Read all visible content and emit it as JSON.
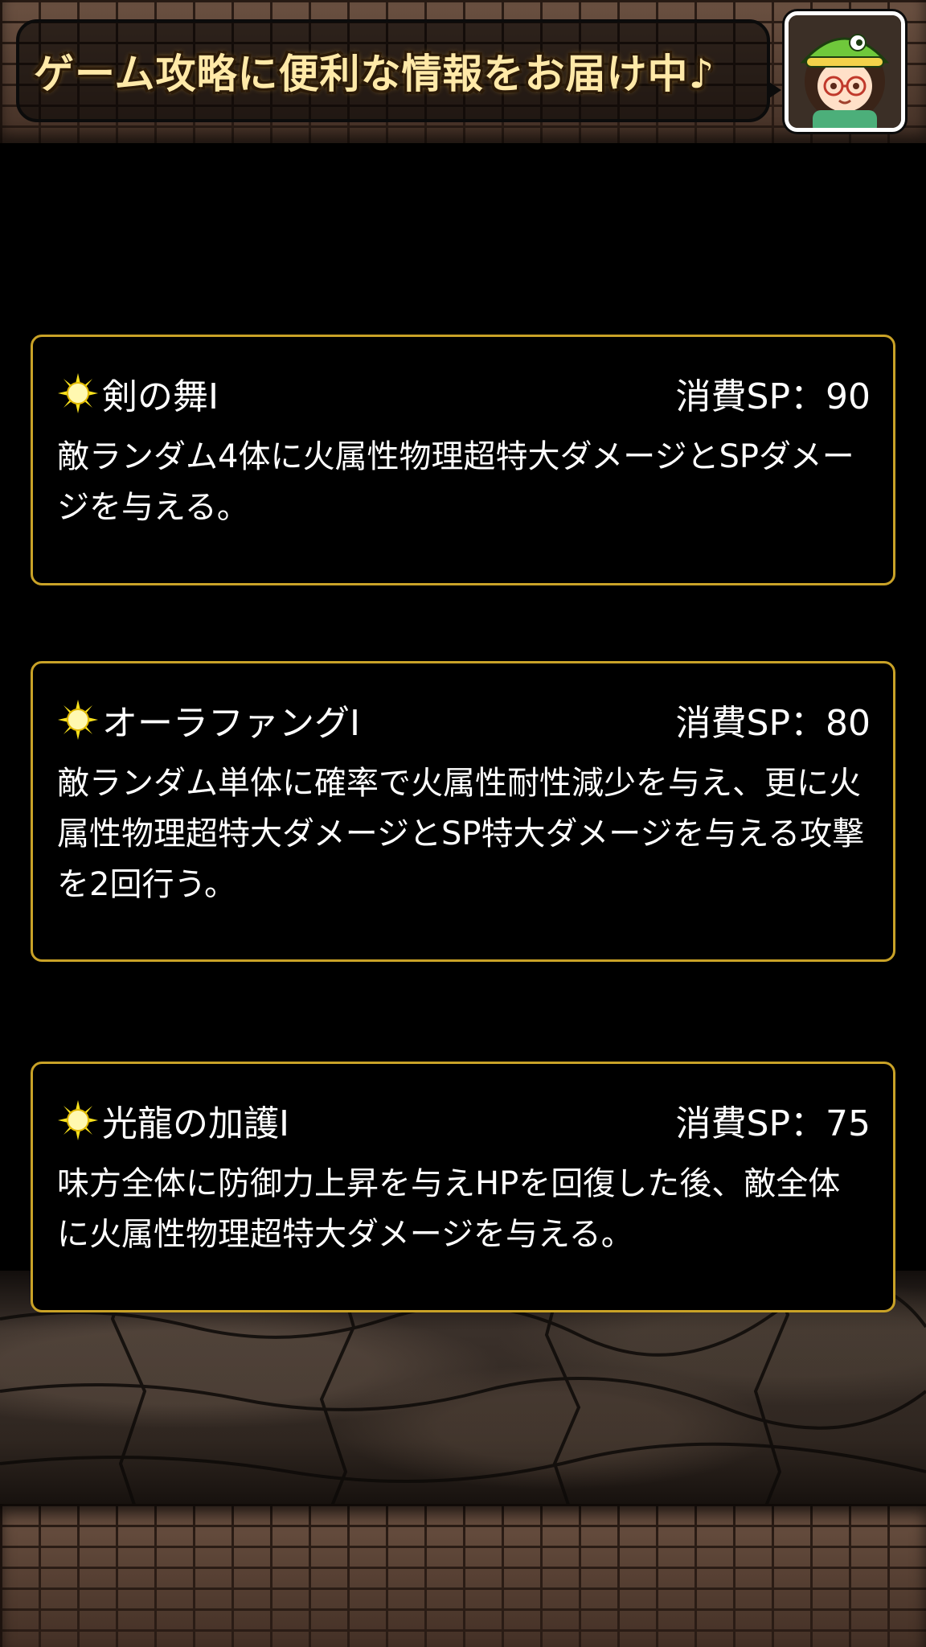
{
  "header": {
    "banner_text": "ゲーム攻略に便利な情報をお届け中♪",
    "avatar_icon": "guide-character-avatar-icon"
  },
  "skills": [
    {
      "icon": "sun-icon",
      "name": "剣の舞Ⅰ",
      "cost": "消費SP：90",
      "description": "敵ランダム4体に火属性物理超特大ダメージとSPダメージを与える。"
    },
    {
      "icon": "sun-icon",
      "name": "オーラファングⅠ",
      "cost": "消費SP：80",
      "description": "敵ランダム単体に確率で火属性耐性減少を与え、更に火属性物理超特大ダメージとSP特大ダメージを与える攻撃を2回行う。"
    },
    {
      "icon": "sun-icon",
      "name": "光龍の加護Ⅰ",
      "cost": "消費SP：75",
      "description": "味方全体に防御力上昇を与えHPを回復した後、敵全体に火属性物理超特大ダメージを与える。"
    }
  ],
  "colors": {
    "card_border": "#c9a227",
    "background": "#000000",
    "banner_text": "#ffe9a8"
  }
}
